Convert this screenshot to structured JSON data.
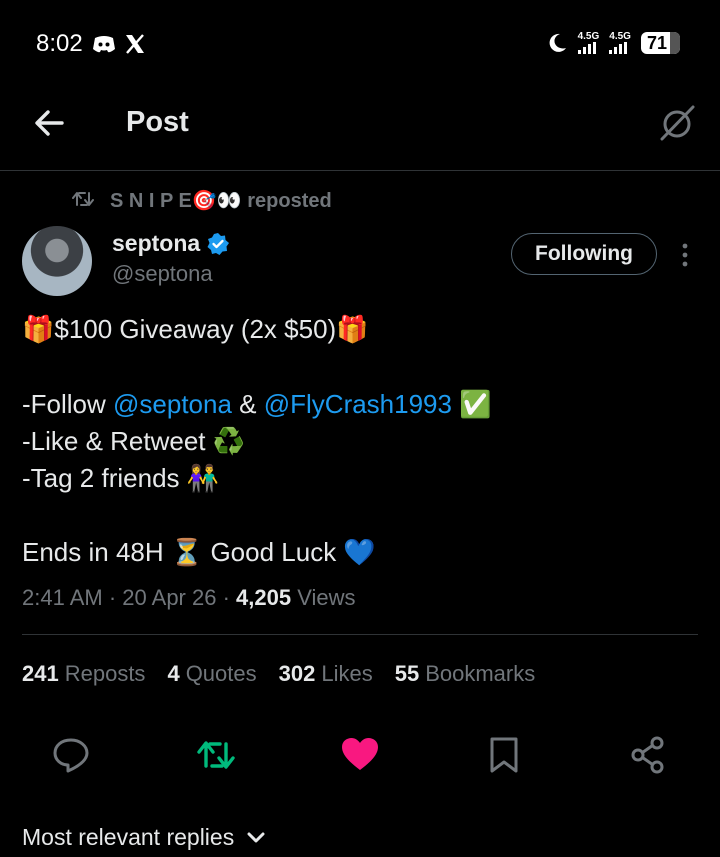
{
  "status_bar": {
    "time": "8:02",
    "signal_1_label": "4.5G",
    "signal_2_label": "4.5G",
    "battery": "71"
  },
  "header": {
    "title": "Post"
  },
  "repost": {
    "text": "S N I P E🎯👀 reposted"
  },
  "author": {
    "name": "septona",
    "handle": "@septona",
    "follow_label": "Following"
  },
  "tweet": {
    "line1": "🎁$100 Giveaway (2x $50)🎁",
    "line2_prefix": "-Follow ",
    "mention1": "@septona",
    "line2_mid": " & ",
    "mention2": "@FlyCrash1993",
    "line2_suffix": " ✅",
    "line3": "-Like & Retweet ♻️",
    "line4": "-Tag 2 friends 👫",
    "line5": "Ends in 48H ⏳ Good Luck 💙",
    "time": "2:41 AM",
    "date": "20 Apr 26",
    "views_count": "4,205",
    "views_label": "Views"
  },
  "stats": {
    "reposts_count": "241",
    "reposts_label": "Reposts",
    "quotes_count": "4",
    "quotes_label": "Quotes",
    "likes_count": "302",
    "likes_label": "Likes",
    "bookmarks_count": "55",
    "bookmarks_label": "Bookmarks"
  },
  "replies": {
    "sort_label": "Most relevant replies"
  },
  "colors": {
    "accent": "#1d9bf0",
    "repost_active": "#00ba7c",
    "like_active": "#f91880",
    "muted": "#71767b"
  },
  "icons": [
    "back-arrow-icon",
    "grok-icon",
    "repost-icon",
    "verified-badge-icon",
    "more-vertical-icon",
    "reply-icon",
    "retweet-icon",
    "heart-icon",
    "bookmark-icon",
    "share-icon",
    "chevron-down-icon"
  ]
}
